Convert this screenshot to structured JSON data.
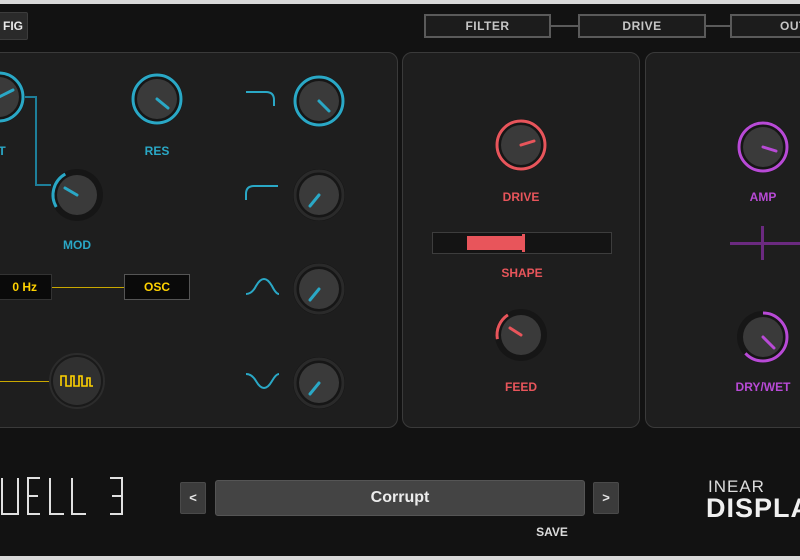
{
  "header": {
    "config_label": "FIG",
    "chain": [
      {
        "label": "FILTER"
      },
      {
        "label": "DRIVE"
      },
      {
        "label": "OUT"
      }
    ]
  },
  "filter_panel": {
    "knob_cut_label": "T",
    "knob_res_label": "RES",
    "knob_mod_label": "MOD",
    "freq_value": "0 Hz",
    "osc_label": "OSC",
    "shape_icons": [
      "highpass-icon",
      "lowpass-icon",
      "bandpass-icon",
      "notch-icon"
    ],
    "wave_icon": "square-wave-icon"
  },
  "drive_panel": {
    "drive_label": "DRIVE",
    "shape_label": "SHAPE",
    "shape_level": 0.5,
    "feed_label": "FEED"
  },
  "output_panel": {
    "amp_label": "AMP",
    "drywet_label": "DRY/WET"
  },
  "footer": {
    "prev_label": "<",
    "next_label": ">",
    "preset_name": "Corrupt",
    "save_label": "SAVE",
    "brand_top": "INEAR",
    "brand_main": "DISPLA"
  },
  "colors": {
    "filter_accent": "#2aa8c6",
    "drive_accent": "#e8555b",
    "output_accent": "#b84ad6",
    "osc_accent": "#ffd200"
  }
}
